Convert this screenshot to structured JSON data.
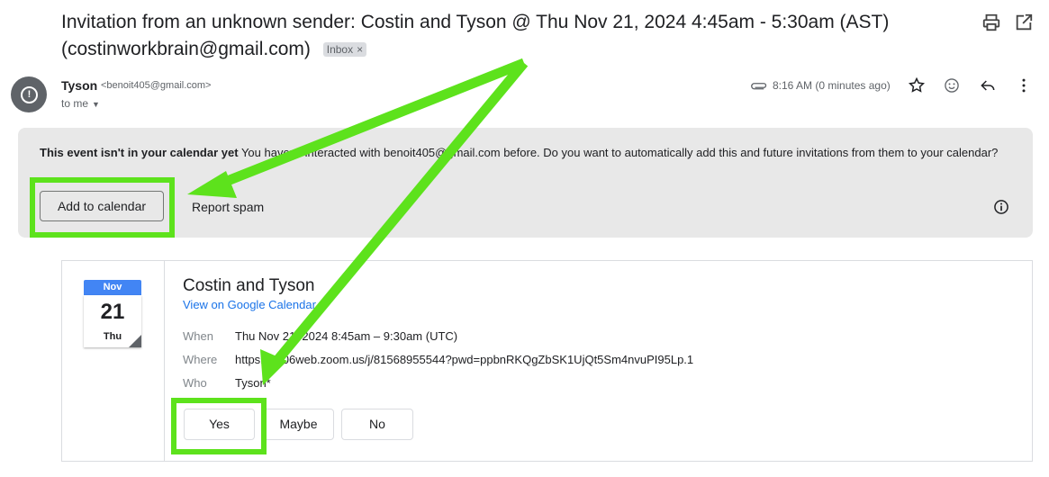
{
  "email": {
    "subject_line1": "Invitation from an unknown sender: Costin and Tyson @ Thu Nov 21, 2024 4:45am - 5:30am (AST)",
    "subject_line2": "(costinworkbrain@gmail.com)",
    "label_badge": "Inbox",
    "label_badge_close": "×",
    "sender_name": "Tyson",
    "sender_email": "<benoit405@gmail.com>",
    "recipient": "to me",
    "time": "8:16 AM (0 minutes ago)"
  },
  "banner": {
    "bold_text": "This event isn't in your calendar yet",
    "message": "You haven't interacted with benoit405@gmail.com before. Do you want to automatically add this and future invitations from them to your calendar?",
    "add_button": "Add to calendar",
    "spam_link": "Report spam"
  },
  "event": {
    "month": "Nov",
    "day": "21",
    "weekday": "Thu",
    "title": "Costin and Tyson",
    "calendar_link": "View on Google Calendar",
    "when_label": "When",
    "when_value": "Thu Nov 21, 2024 8:45am – 9:30am (UTC)",
    "where_label": "Where",
    "where_value": "https://us06web.zoom.us/j/81568955544?pwd=ppbnRKQgZbSK1UjQt5Sm4nvuPI95Lp.1",
    "who_label": "Who",
    "who_value": "Tyson*"
  },
  "rsvp": {
    "yes": "Yes",
    "maybe": "Maybe",
    "no": "No"
  },
  "colors": {
    "annotation_green": "#5de21c",
    "link_blue": "#1a73e8",
    "calendar_blue": "#4285f4",
    "banner_gray": "#e8e8e8"
  },
  "icons": [
    "print-icon",
    "open-in-new-icon",
    "alert-icon",
    "attachment-icon",
    "star-icon",
    "emoji-icon",
    "reply-icon",
    "more-vert-icon",
    "info-icon"
  ]
}
